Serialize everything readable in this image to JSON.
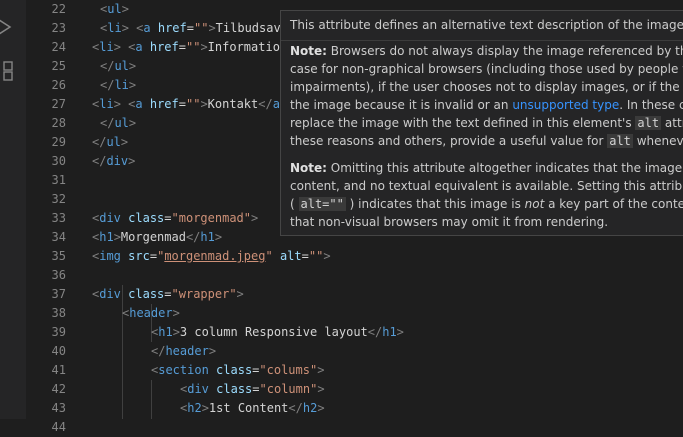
{
  "gutter": {
    "line_numbers": [
      "22",
      "23",
      "24",
      "25",
      "26",
      "27",
      "28",
      "29",
      "30",
      "31",
      "32",
      "33",
      "34",
      "35",
      "36",
      "37",
      "38",
      "39",
      "40",
      "41",
      "42",
      "43",
      "44"
    ]
  },
  "code": {
    "l22": [
      "<",
      "ul",
      ">"
    ],
    "l23": [
      "<",
      "li",
      "> <",
      "a",
      " ",
      "href",
      "=",
      "\"\"",
      ">",
      "Tilbudsav"
    ],
    "l24": [
      "<",
      "li",
      "> <",
      "a",
      " ",
      "href",
      "=",
      "\"\"",
      ">",
      "Informatio"
    ],
    "l25": [
      "</",
      "ul",
      ">"
    ],
    "l26": [
      "</",
      "li",
      ">"
    ],
    "l27": [
      "<",
      "li",
      "> <",
      "a",
      " ",
      "href",
      "=",
      "\"\"",
      ">",
      "Kontakt",
      "</",
      "a"
    ],
    "l28": [
      "</",
      "ul",
      ">"
    ],
    "l29": [
      "</",
      "ul",
      ">"
    ],
    "l30": [
      "</",
      "div",
      ">"
    ],
    "l33": [
      "<",
      "div",
      " ",
      "class",
      "=",
      "\"morgenmad\"",
      ">"
    ],
    "l34": [
      "<",
      "h1",
      ">",
      "Morgenmad",
      "</",
      "h1",
      ">"
    ],
    "l35": [
      "<",
      "img",
      " ",
      "src",
      "=",
      "\"",
      "morgenmad.jpeg",
      "\"",
      " ",
      "alt",
      "=",
      "\"\"",
      ">"
    ],
    "l37": [
      "<",
      "div",
      " ",
      "class",
      "=",
      "\"wrapper\"",
      ">"
    ],
    "l38": [
      "<",
      "header",
      ">"
    ],
    "l39": [
      "<",
      "h1",
      ">",
      "3 column Responsive layout",
      "</",
      "h1",
      ">"
    ],
    "l40": [
      "</",
      "header",
      ">"
    ],
    "l42": [
      "<",
      "section",
      " ",
      "class",
      "=",
      "\"colums\"",
      ">"
    ],
    "l43": [
      "<",
      "div",
      " ",
      "class",
      "=",
      "\"column\"",
      ">"
    ],
    "l44": [
      "<",
      "h2",
      ">",
      "1st Content",
      "</",
      "h2",
      ">"
    ]
  },
  "hover": {
    "line1": "This attribute defines an alternative text description of the image.",
    "note1_label": "Note:",
    "note1_l1": " Browsers do not always display the image referenced by the ele",
    "note1_l2": "case for non-graphical browsers (including those used by people with",
    "note1_l3": "impairments), if the user chooses not to display images, or if the brow",
    "note1_l4a": "the image because it is invalid or an ",
    "note1_link": "unsupported type",
    "note1_l4b": ". In these cases",
    "note1_l5a": "replace the image with the text defined in this element's ",
    "note1_code1": "alt",
    "note1_l5b": " attribut",
    "note1_l6a": "these reasons and others, provide a useful value for ",
    "note1_code2": "alt",
    "note1_l6b": " whenever p",
    "note2_label": "Note:",
    "note2_l1": " Omitting this attribute altogether indicates that the image is a k",
    "note2_l2": "content, and no textual equivalent is available. Setting this attribute to",
    "note2_l3a": "( ",
    "note2_code": "alt=\"\"",
    "note2_l3b": " ) indicates that this image is ",
    "note2_em": "not",
    "note2_l3c": " a key part of the content (d",
    "note2_l4": "that non-visual browsers may omit it from rendering."
  }
}
